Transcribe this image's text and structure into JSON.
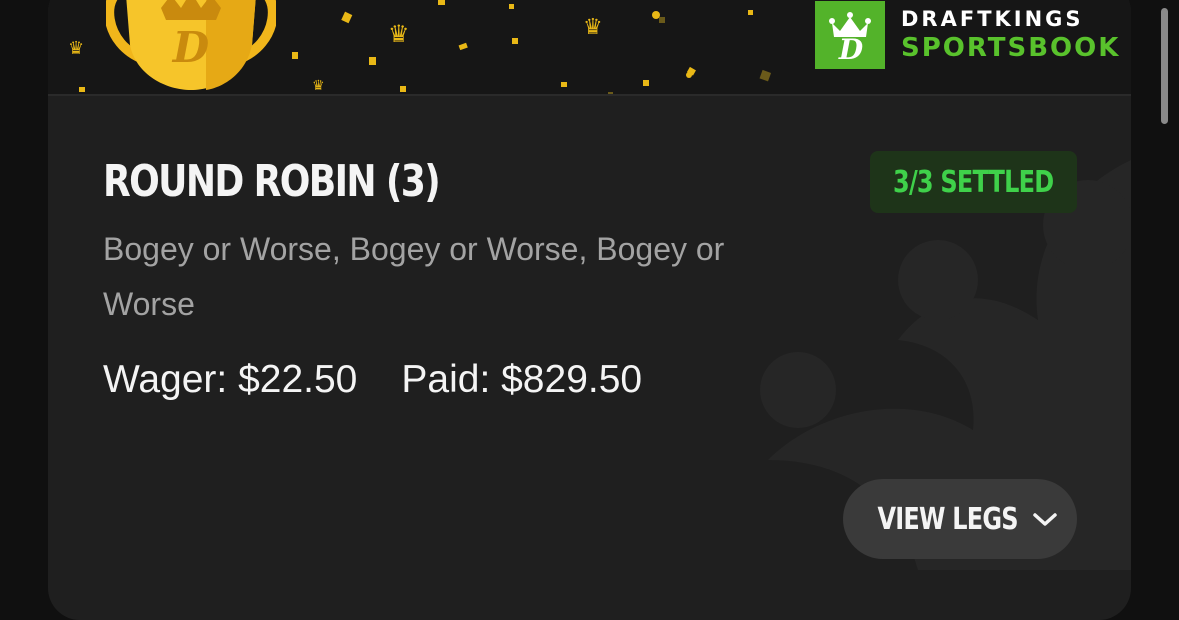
{
  "brand": {
    "line1": "DRAFTKINGS",
    "line2": "SPORTSBOOK",
    "logo_icon": "draftkings-crown-d-logo",
    "accent_green": "#53b32a"
  },
  "bet": {
    "title": "ROUND ROBIN (3)",
    "status": "3/3 SETTLED",
    "legs_summary": "Bogey or Worse, Bogey or Worse, Bogey or Worse",
    "wager": "Wager: $22.50",
    "paid": "Paid: $829.50",
    "status_color": "#3fd14a"
  },
  "actions": {
    "view_legs_label": "VIEW LEGS",
    "view_legs_icon": "chevron-down-icon"
  }
}
